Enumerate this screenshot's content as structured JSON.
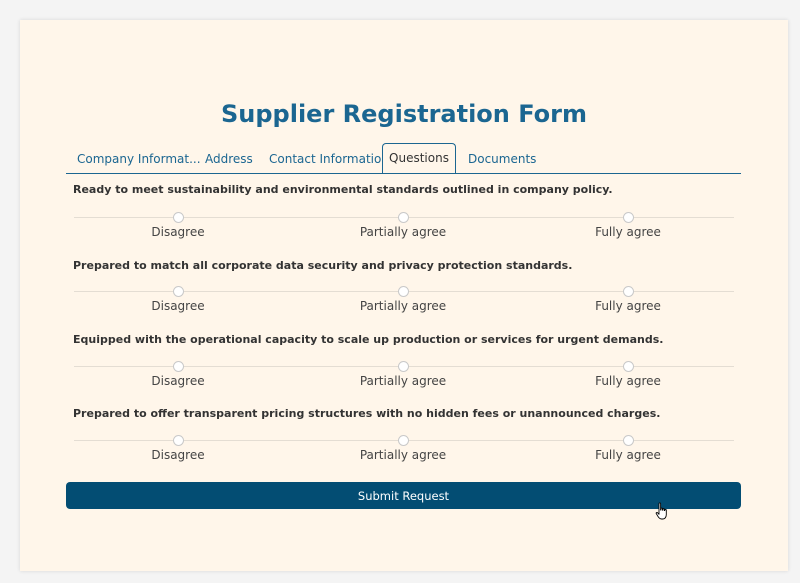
{
  "form": {
    "title": "Supplier Registration Form",
    "tabs": [
      {
        "label": "Company Informat..."
      },
      {
        "label": "Address"
      },
      {
        "label": "Contact Information"
      },
      {
        "label": "Questions",
        "active": true
      },
      {
        "label": "Documents"
      }
    ],
    "questions": [
      {
        "text": "Ready to meet sustainability and environmental standards outlined in company policy.",
        "options": [
          "Disagree",
          "Partially agree",
          "Fully agree"
        ]
      },
      {
        "text": "Prepared to match all corporate data security and privacy protection standards.",
        "options": [
          "Disagree",
          "Partially agree",
          "Fully agree"
        ]
      },
      {
        "text": "Equipped with the operational capacity to scale up production or services for urgent demands.",
        "options": [
          "Disagree",
          "Partially agree",
          "Fully agree"
        ]
      },
      {
        "text": "Prepared to offer transparent pricing structures with no hidden fees or unannounced charges.",
        "options": [
          "Disagree",
          "Partially agree",
          "Fully agree"
        ]
      }
    ],
    "submit_label": "Submit Request"
  },
  "colors": {
    "page_background": "#f4f4f4",
    "card_background": "#fff6ea",
    "accent": "#1b6691",
    "button": "#034d73"
  },
  "icons": {
    "cursor": "hand-pointer-icon"
  }
}
